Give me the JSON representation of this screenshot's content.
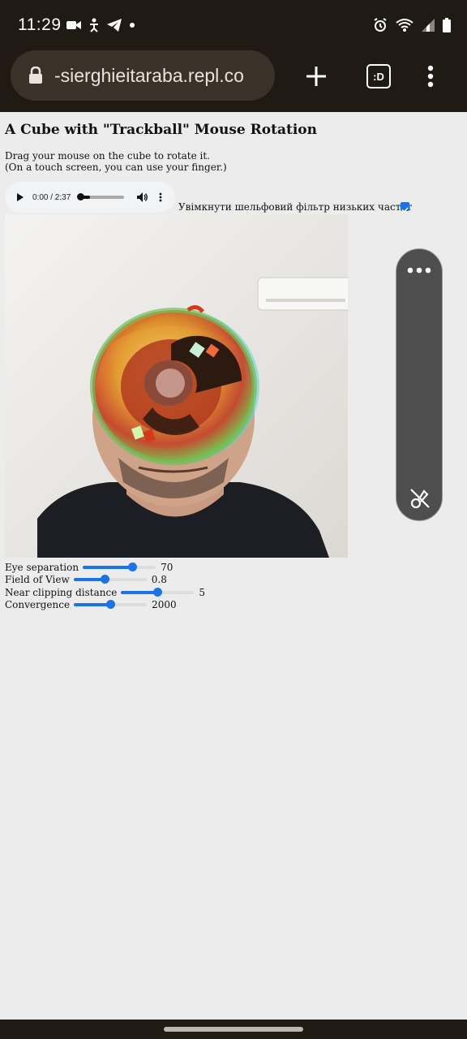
{
  "status_bar": {
    "time": "11:29"
  },
  "browser": {
    "url": "-sierghieitaraba.repl.co",
    "tab_switcher_label": ":D"
  },
  "page": {
    "title": "A Cube with \"Trackball\" Mouse Rotation",
    "desc_line1": "Drag your mouse on the cube to rotate it.",
    "desc_line2": "(On a touch screen, you can use your finger.)"
  },
  "audio": {
    "time": "0:00 / 2:37",
    "progress": 0
  },
  "filter": {
    "label": "Увімкнути шельфовий фільтр низьких частот",
    "checked": true
  },
  "controls": [
    {
      "label": "Eye separation",
      "value": "70",
      "level": 0.68
    },
    {
      "label": "Field of View",
      "value": "0.8",
      "level": 0.43
    },
    {
      "label": "Near clipping distance",
      "value": "5",
      "level": 0.5
    },
    {
      "label": "Convergence",
      "value": "2000",
      "level": 0.5
    }
  ],
  "colors": {
    "accent": "#1a73e8",
    "chrome": "#1f1a14",
    "page_bg": "#ececec"
  }
}
